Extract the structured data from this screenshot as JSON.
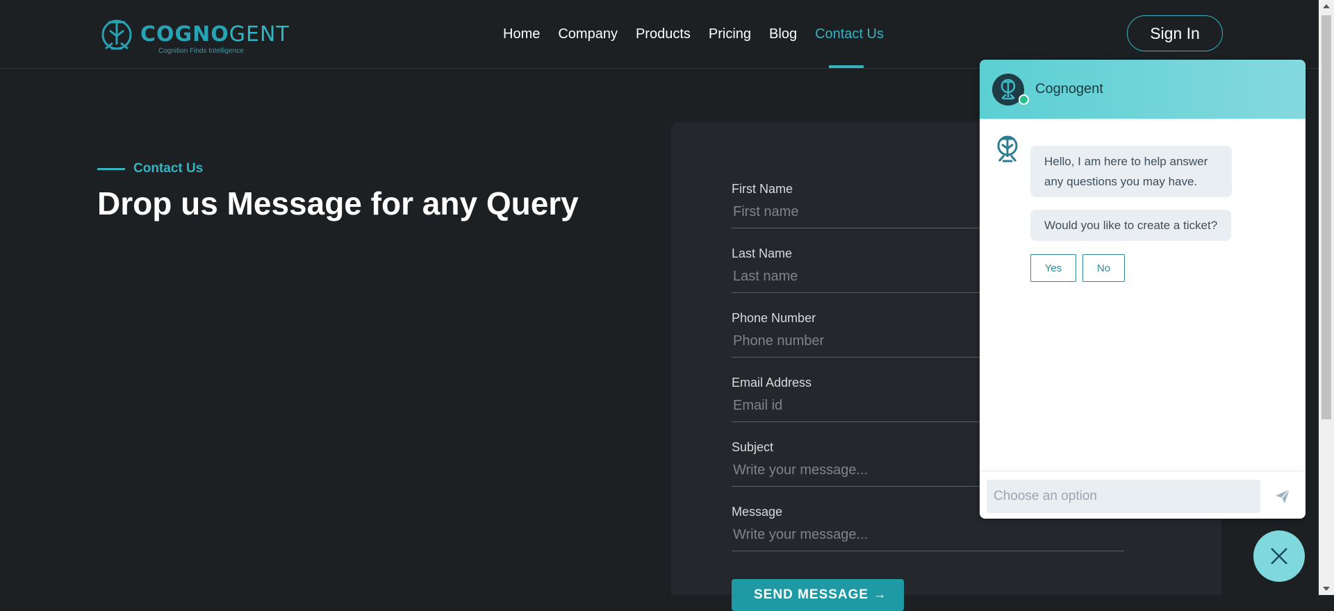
{
  "header": {
    "logo_brand_bold": "COGNO",
    "logo_brand_light": "GENT",
    "logo_tagline": "Cognition Finds Intelligence",
    "nav": {
      "home": "Home",
      "company": "Company",
      "products": "Products",
      "pricing": "Pricing",
      "blog": "Blog",
      "contact": "Contact Us"
    },
    "signin_label": "Sign In"
  },
  "hero": {
    "eyebrow": "Contact Us",
    "title": "Drop us Message for any Query"
  },
  "form": {
    "fields": [
      {
        "label": "First Name",
        "placeholder": "First name"
      },
      {
        "label": "Last Name",
        "placeholder": "Last name"
      },
      {
        "label": "Phone Number",
        "placeholder": "Phone number"
      },
      {
        "label": "Email Address",
        "placeholder": "Email id"
      },
      {
        "label": "Subject",
        "placeholder": "Write your message..."
      },
      {
        "label": "Message",
        "placeholder": "Write your message..."
      }
    ],
    "submit_label": "SEND MESSAGE →"
  },
  "chat": {
    "title": "Cognogent",
    "messages": [
      "Hello, I am here to help answer any questions you may have.",
      "Would you like to create a ticket?"
    ],
    "options": {
      "yes": "Yes",
      "no": "No"
    },
    "input_placeholder": "Choose an option"
  },
  "colors": {
    "accent": "#35b4c0",
    "background": "#1d2023",
    "panel": "#24282c",
    "chat_header": "#6fd4d8"
  },
  "icons": {
    "logo": "cognogent-logo-icon",
    "bot": "bot-avatar-icon",
    "send": "paper-plane-icon",
    "close": "close-icon"
  }
}
